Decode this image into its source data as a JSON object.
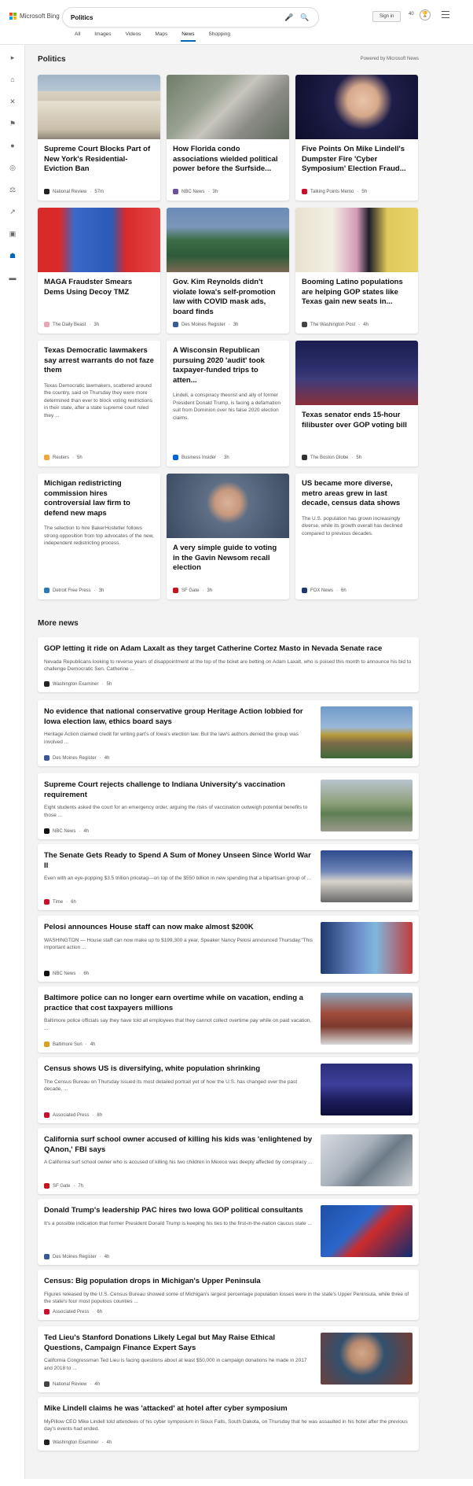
{
  "brand": {
    "name": "Microsoft Bing"
  },
  "search": {
    "query": "Politics"
  },
  "header": {
    "signin": "Sign in",
    "points": "40"
  },
  "tabs": [
    "All",
    "Images",
    "Videos",
    "Maps",
    "News",
    "Shopping"
  ],
  "section": {
    "title": "Politics",
    "powered": "Powered by Microsoft News"
  },
  "cards": [
    {
      "title": "Supreme Court Blocks Part of New York's Residential-Eviction Ban",
      "snippet": "",
      "source": "National Review",
      "time": "57m",
      "img": "court"
    },
    {
      "title": "How Florida condo associations wielded political power before the Surfside...",
      "snippet": "",
      "source": "NBC News",
      "time": "3h",
      "img": "condo"
    },
    {
      "title": "Five Points On Mike Lindell's Dumpster Fire 'Cyber Symposium' Election Fraud...",
      "snippet": "",
      "source": "Talking Points Memo",
      "time": "5h",
      "img": "lindell"
    },
    {
      "title": "MAGA Fraudster Smears Dems Using Decoy TMZ",
      "snippet": "",
      "source": "The Daily Beast",
      "time": "3h",
      "img": "maga"
    },
    {
      "title": "Gov. Kim Reynolds didn't violate Iowa's self-promotion law with COVID mask ads, board finds",
      "snippet": "",
      "source": "Des Moines Register",
      "time": "3h",
      "img": "reynolds"
    },
    {
      "title": "Booming Latino populations are helping GOP states like Texas gain new seats in...",
      "snippet": "",
      "source": "The Washington Post",
      "time": "4h",
      "img": "latino"
    },
    {
      "title": "Texas Democratic lawmakers say arrest warrants do not faze them",
      "snippet": "Texas Democratic lawmakers, scattered around the country, said on Thursday they were more determined than ever to block voting restrictions in their state, after a state supreme court ruled they ...",
      "source": "Reuters",
      "time": "5h",
      "img": ""
    },
    {
      "title": "A Wisconsin Republican pursuing 2020 'audit' took taxpayer-funded trips to atten...",
      "snippet": "Lindell, a conspiracy theorist and ally of former President Donald Trump, is facing a defamation suit from Dominion over his false 2020 election claims.",
      "source": "Business Insider",
      "time": "3h",
      "img": ""
    },
    {
      "title": "Texas senator ends 15-hour filibuster over GOP voting bill",
      "snippet": "",
      "source": "The Boston Globe",
      "time": "5h",
      "img": "senate"
    },
    {
      "title": "Michigan redistricting commission hires controversial law firm to defend new maps",
      "snippet": "The selection to hire BakerHostetler follows strong opposition from top advocates of the new, independent redistricting process.",
      "source": "Detroit Free Press",
      "time": "3h",
      "img": ""
    },
    {
      "title": "A very simple guide to voting in the Gavin Newsom recall election",
      "snippet": "",
      "source": "SF Gate",
      "time": "3h",
      "img": "newsom"
    },
    {
      "title": "US became more diverse, metro areas grew in last decade, census data shows",
      "snippet": "The U.S. population has grown increasingly diverse, while its growth overall has declined compared to previous decades.",
      "source": "FOX News",
      "time": "6h",
      "img": ""
    }
  ],
  "more": {
    "title": "More news",
    "items": [
      {
        "title": "GOP letting it ride on Adam Laxalt as they target Catherine Cortez Masto in Nevada Senate race",
        "snippet": "Nevada Republicans looking to reverse years of disappointment at the top of the ticket are betting on Adam Laxalt, who is poised this month to announce his bid to challenge Democratic Sen. Catherine ...",
        "source": "Washington Examiner",
        "time": "5h",
        "thumb": ""
      },
      {
        "title": "No evidence that national conservative group Heritage Action lobbied for Iowa election law, ethics board says",
        "snippet": "Heritage Action claimed credit for writing part's of Iowa's election law. But the law's authors denied the group was involved ...",
        "source": "Des Moines Register",
        "time": "4h",
        "thumb": "capitol"
      },
      {
        "title": "Supreme Court rejects challenge to Indiana University's vaccination requirement",
        "snippet": "Eight students asked the court for an emergency order, arguing the risks of vaccination outweigh potential benefits to those ...",
        "source": "NBC News",
        "time": "4h",
        "thumb": "campus"
      },
      {
        "title": "The Senate Gets Ready to Spend A Sum of Money Unseen Since World War II",
        "snippet": "Even with an eye-popping $3.5 trillion pricetag—on top of the $550 billion in new spending that a bipartisan group of ...",
        "source": "Time",
        "time": "6h",
        "thumb": "uscapitol"
      },
      {
        "title": "Pelosi announces House staff can now make almost $200K",
        "snippet": "WASHINGTON — House staff can now make up to $199,300 a year, Speaker Nancy Pelosi announced Thursday.\"This important action ...",
        "source": "NBC News",
        "time": "6h",
        "thumb": "pelosi"
      },
      {
        "title": "Baltimore police can no longer earn overtime while on vacation, ending a practice that cost taxpayers millions",
        "snippet": "Baltimore police officials say they have told all employees that they cannot collect overtime pay while on paid vacation, ...",
        "source": "Baltimore Sun",
        "time": "4h",
        "thumb": "baltimore"
      },
      {
        "title": "Census shows US is diversifying, white population shrinking",
        "snippet": "The Census Bureau on Thursday issued its most detailed portrait yet of how the U.S. has changed over the past decade, ...",
        "source": "Associated Press",
        "time": "8h",
        "thumb": "skyline"
      },
      {
        "title": "California surf school owner accused of killing his kids was 'enlightened by QAnon,' FBI says",
        "snippet": "A California surf school owner who is accused of killing his two children in Mexico was deeply affected by conspiracy ...",
        "source": "SF Gate",
        "time": "7h",
        "thumb": "surf"
      },
      {
        "title": "Donald Trump's leadership PAC hires two Iowa GOP political consultants",
        "snippet": "It's a possible indication that former President Donald Trump is keeping his ties to the first-in-the-nation caucus state ...",
        "source": "Des Moines Register",
        "time": "4h",
        "thumb": "trump"
      },
      {
        "title": "Census: Big population drops in Michigan's Upper Peninsula",
        "snippet": "Figures released by the U.S. Census Bureau showed some of Michigan's largest percentage population losses were in the state's Upper Peninsula, while three of the state's four most populous counties ...",
        "source": "Associated Press",
        "time": "6h",
        "thumb": ""
      },
      {
        "title": "Ted Lieu's Stanford Donations Likely Legal but May Raise Ethical Questions, Campaign Finance Expert Says",
        "snippet": "California Congressman Ted Lieu is facing questions about at least $50,000 in campaign donations he made in 2017 and 2018 to ...",
        "source": "National Review",
        "time": "4h",
        "thumb": "lieu"
      },
      {
        "title": "Mike Lindell claims he was 'attacked' at hotel after cyber symposium",
        "snippet": "MyPillow CEO Mike Lindell told attendees of his cyber symposium in Sioux Falls, South Dakota, on Thursday that he was assaulted in his hotel after the previous day's events had ended.",
        "source": "Washington Examiner",
        "time": "4h",
        "thumb": ""
      }
    ]
  }
}
